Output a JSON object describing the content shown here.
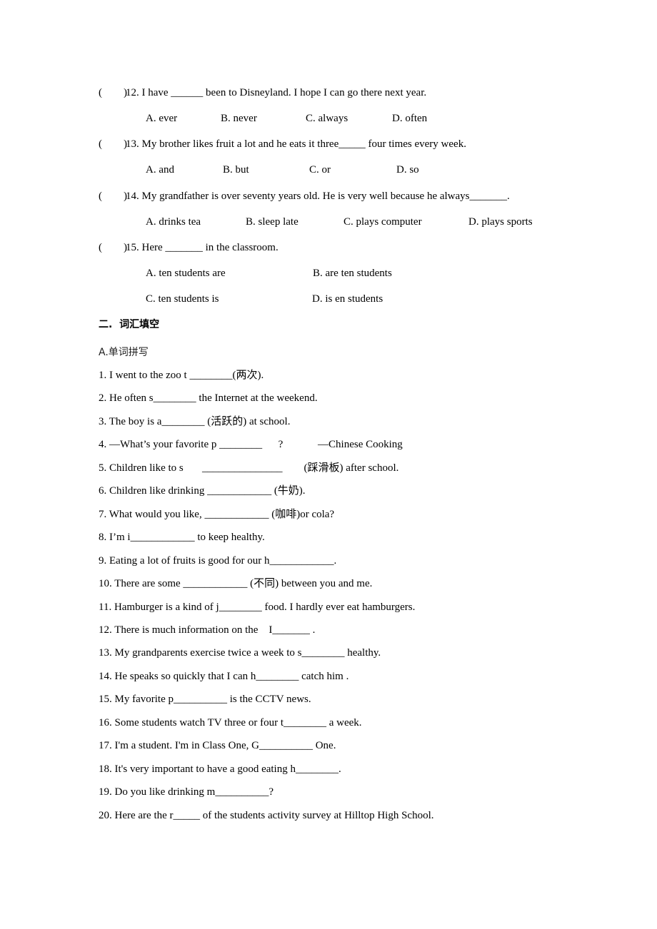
{
  "choice_questions": [
    {
      "paren": "(        )",
      "text": "12. I have ______ been to Disneyland. I hope I can go there next year.",
      "options": [
        "A. ever",
        "B. never",
        "C. always",
        "D. often"
      ]
    },
    {
      "paren": "(        )",
      "text": "13. My brother likes fruit a lot and he eats it three_____ four times every week.",
      "options": [
        "A. and",
        "B. but",
        "C. or",
        "D. so"
      ]
    },
    {
      "paren": "(        )",
      "text": "14. My grandfather is over seventy years old. He is very well because he always_______.",
      "options": [
        "A. drinks tea",
        "B. sleep late",
        "C. plays computer",
        "D. plays sports"
      ]
    },
    {
      "paren": "(        )",
      "text": "15. Here _______ in the classroom.",
      "options": [
        "A. ten students are",
        "B. are ten students",
        "C. ten students is",
        "D. is en students"
      ]
    }
  ],
  "section2": {
    "heading": "二.  词汇填空",
    "subheading": "A.单词拼写",
    "items": [
      "1. I went to the zoo t ________(两次).",
      "2. He often s________ the Internet at the weekend.",
      "3. The boy is a________ (活跃的) at school.",
      "4. —What’s your favorite p ________      ?             —Chinese Cooking",
      "5. Children like to s       _______________        (踩滑板) after school.",
      "6. Children like drinking ____________ (牛奶).",
      "7. What would you like, ____________ (咖啡)or cola?",
      "8. I’m i____________ to keep healthy.",
      "9. Eating a lot of fruits is good for our h____________.",
      "10. There are some ____________ (不同) between you and me.",
      "11. Hamburger is a kind of j________ food. I hardly ever eat hamburgers.",
      "12. There is much information on the    I_______ .",
      "13. My grandparents exercise twice a week to s________ healthy.",
      "14. He speaks so quickly that I can h________ catch him .",
      "15. My favorite p__________ is the CCTV news.",
      "16. Some students watch TV three or four t________ a week.",
      "17. I'm a student. I'm in Class One, G__________ One.",
      "18. It's very important to have a good eating h________.",
      "19. Do you like drinking m__________?",
      "20. Here are the r_____ of the students activity survey at Hilltop High School."
    ]
  }
}
